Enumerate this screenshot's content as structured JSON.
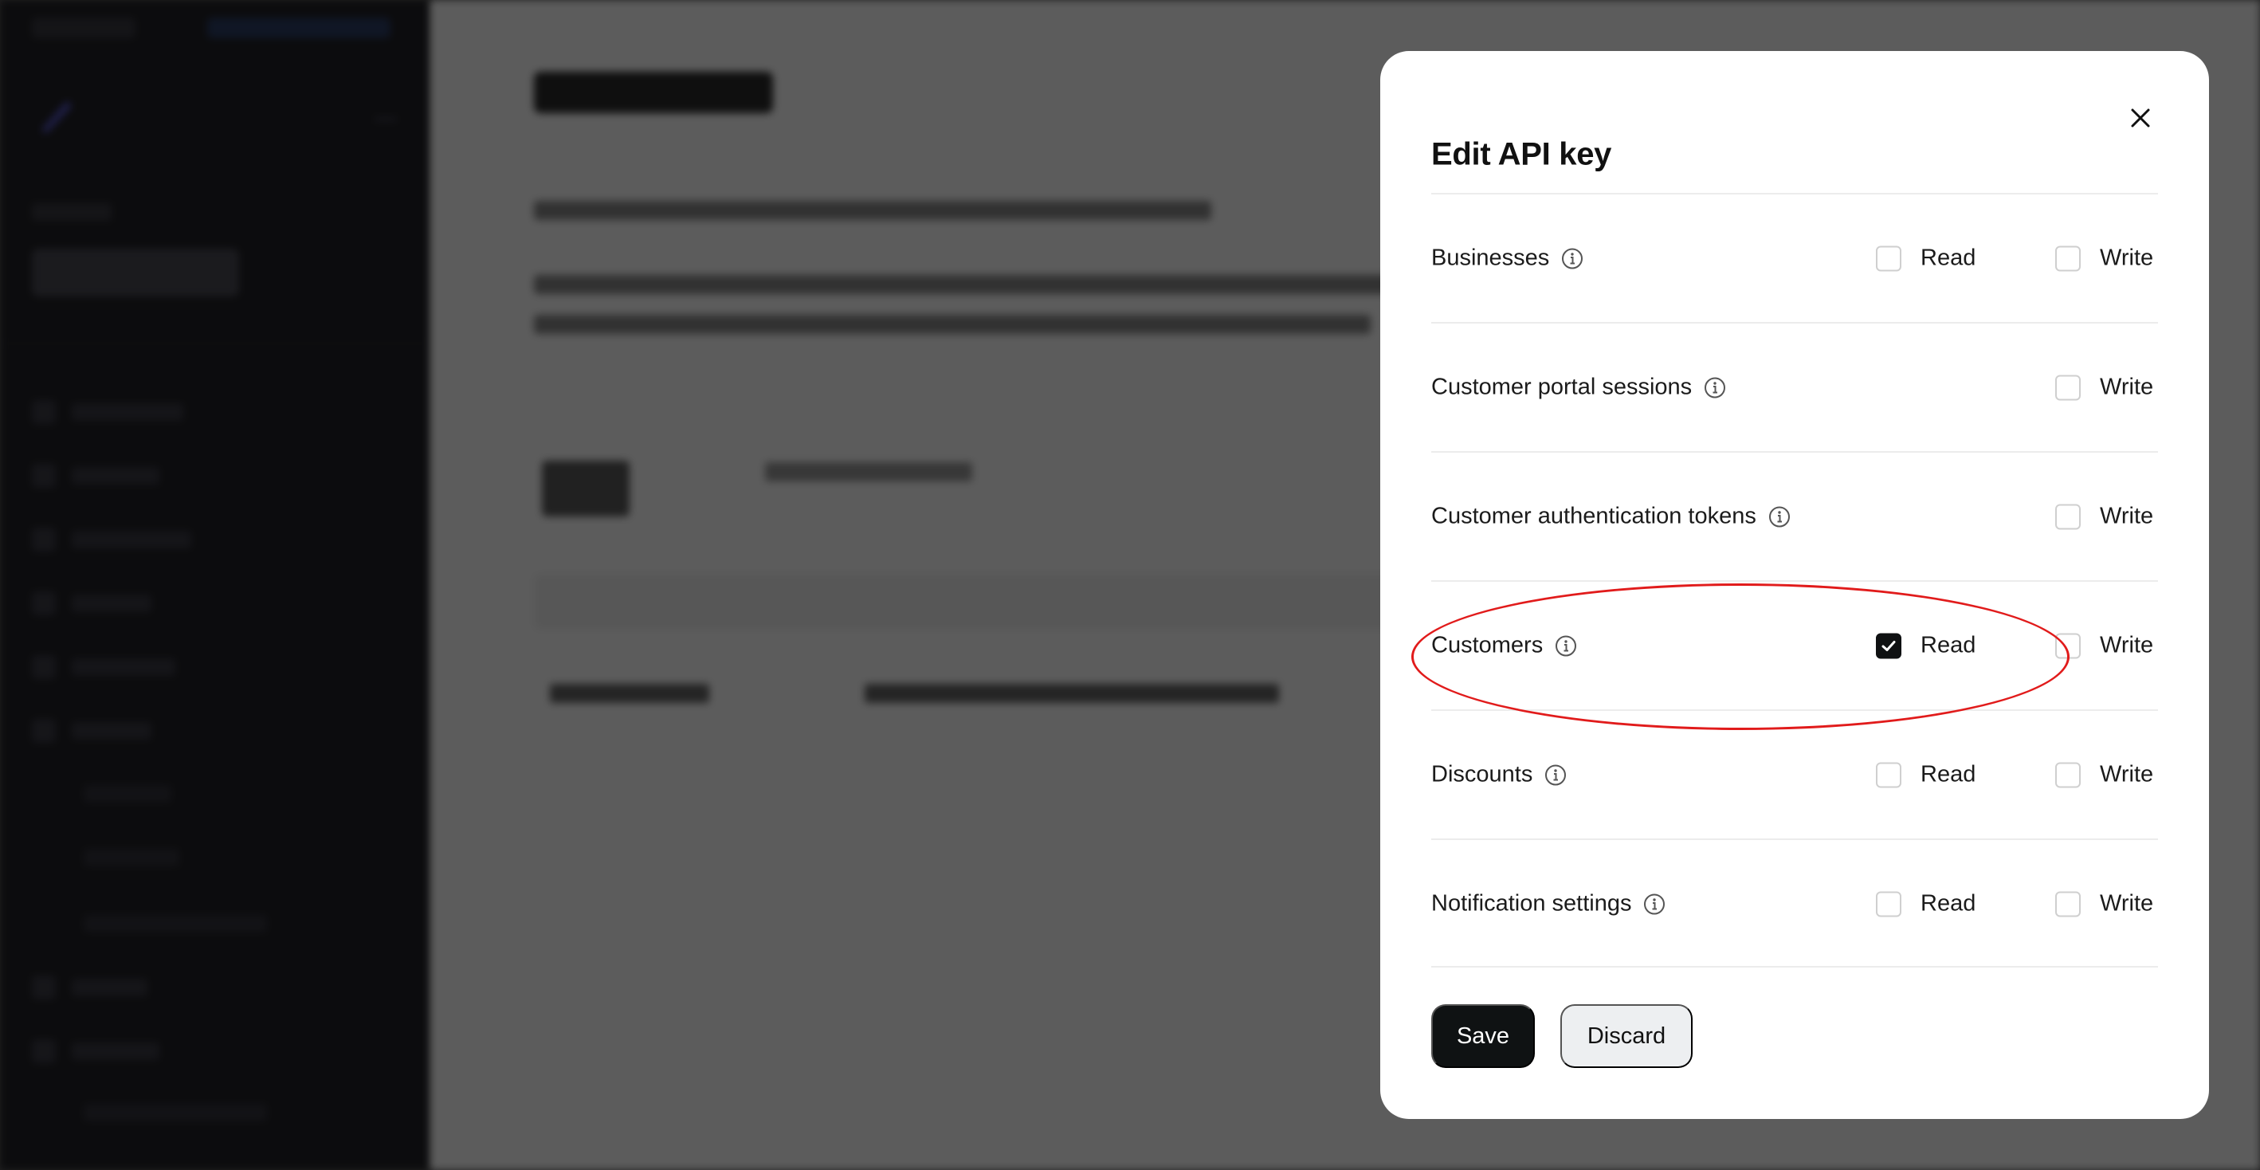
{
  "modal": {
    "title": "Edit API key",
    "close_icon": "close-icon",
    "read_label": "Read",
    "write_label": "Write",
    "permissions": [
      {
        "label": "Businesses",
        "has_read": true,
        "has_write": true,
        "read": false,
        "write": false
      },
      {
        "label": "Customer portal sessions",
        "has_read": false,
        "has_write": true,
        "read": false,
        "write": false
      },
      {
        "label": "Customer authentication tokens",
        "has_read": false,
        "has_write": true,
        "read": false,
        "write": false
      },
      {
        "label": "Customers",
        "has_read": true,
        "has_write": true,
        "read": true,
        "write": false
      },
      {
        "label": "Discounts",
        "has_read": true,
        "has_write": true,
        "read": false,
        "write": false
      },
      {
        "label": "Notification settings",
        "has_read": true,
        "has_write": true,
        "read": false,
        "write": false
      }
    ],
    "save_label": "Save",
    "discard_label": "Discard"
  },
  "colors": {
    "primary_button": "#0f1213",
    "secondary_button": "#edeff1",
    "highlight": "#e11b1b",
    "sidebar": "#222227"
  }
}
